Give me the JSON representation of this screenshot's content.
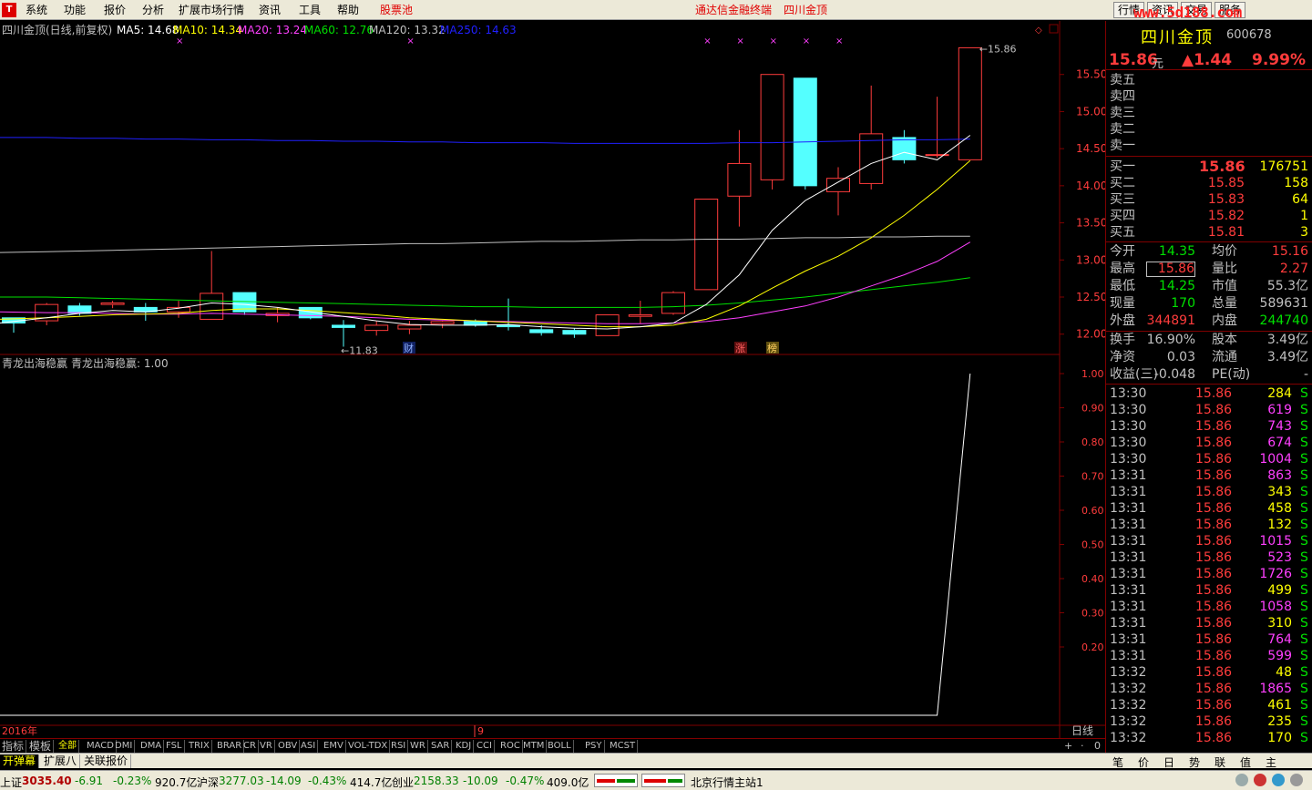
{
  "menu": [
    "系统",
    "功能",
    "报价",
    "分析",
    "扩展市场行情",
    "资讯",
    "工具",
    "帮助"
  ],
  "menu_red": "股票池",
  "center_title": "通达信金融终端",
  "center_stock": "四川金顶",
  "right_buttons": [
    "行情",
    "资讯",
    "交易",
    "服务"
  ],
  "watermark": "www.5d188.com",
  "header": {
    "title": "四川金顶(日线,前复权)",
    "ma5": "MA5: 14.68",
    "ma10": "MA10: 14.34",
    "ma20": "MA20: 13.24",
    "ma60": "MA60: 12.76",
    "ma120": "MA120: 13.32",
    "ma250": "MA250: 14.63"
  },
  "colors": {
    "ma5": "#ffffff",
    "ma10": "#ffff00",
    "ma20": "#ff40ff",
    "ma60": "#00e000",
    "ma120": "#c0c0c0",
    "ma250": "#2020ff",
    "up": "#ff3c3c",
    "down": "#54ffff"
  },
  "price_axis": [
    "15.50",
    "15.00",
    "14.50",
    "14.00",
    "13.50",
    "13.00",
    "12.50",
    "12.00"
  ],
  "labels": {
    "high_label": "15.86",
    "low_label": "11.83",
    "cai": "财",
    "zhang": "涨",
    "bang": "榜"
  },
  "indicator": {
    "title": "青龙出海稳赢",
    "value": "青龙出海稳赢: 1.00",
    "axis": [
      "1.00",
      "0.90",
      "0.80",
      "0.70",
      "0.60",
      "0.50",
      "0.40",
      "0.30",
      "0.20"
    ]
  },
  "x_axis": {
    "year": "2016年",
    "month": "9",
    "period": "日线"
  },
  "chart_data": {
    "type": "candlestick",
    "ylim": [
      11.8,
      16.0
    ],
    "candles": [
      {
        "o": 12.22,
        "h": 12.22,
        "l": 12.02,
        "c": 12.15
      },
      {
        "o": 12.18,
        "h": 12.42,
        "l": 12.12,
        "c": 12.4
      },
      {
        "o": 12.38,
        "h": 12.42,
        "l": 12.25,
        "c": 12.28
      },
      {
        "o": 12.4,
        "h": 12.45,
        "l": 12.35,
        "c": 12.42
      },
      {
        "o": 12.36,
        "h": 12.42,
        "l": 12.18,
        "c": 12.3
      },
      {
        "o": 12.3,
        "h": 12.45,
        "l": 12.22,
        "c": 12.36
      },
      {
        "o": 12.2,
        "h": 13.12,
        "l": 12.2,
        "c": 12.55
      },
      {
        "o": 12.56,
        "h": 12.56,
        "l": 12.26,
        "c": 12.3
      },
      {
        "o": 12.25,
        "h": 12.36,
        "l": 12.16,
        "c": 12.28
      },
      {
        "o": 12.36,
        "h": 12.36,
        "l": 12.2,
        "c": 12.22
      },
      {
        "o": 12.12,
        "h": 12.19,
        "l": 11.83,
        "c": 12.09
      },
      {
        "o": 12.05,
        "h": 12.18,
        "l": 11.98,
        "c": 12.12
      },
      {
        "o": 12.07,
        "h": 12.18,
        "l": 12.0,
        "c": 12.12
      },
      {
        "o": 12.14,
        "h": 12.18,
        "l": 12.08,
        "c": 12.17
      },
      {
        "o": 12.17,
        "h": 12.2,
        "l": 12.1,
        "c": 12.12
      },
      {
        "o": 12.12,
        "h": 12.48,
        "l": 12.05,
        "c": 12.1
      },
      {
        "o": 12.06,
        "h": 12.12,
        "l": 11.98,
        "c": 12.02
      },
      {
        "o": 12.05,
        "h": 12.08,
        "l": 11.95,
        "c": 12.0
      },
      {
        "o": 11.98,
        "h": 12.24,
        "l": 11.98,
        "c": 12.26
      },
      {
        "o": 12.24,
        "h": 12.45,
        "l": 12.14,
        "c": 12.26
      },
      {
        "o": 12.28,
        "h": 12.58,
        "l": 12.26,
        "c": 12.56
      },
      {
        "o": 12.6,
        "h": 13.82,
        "l": 12.6,
        "c": 13.82
      },
      {
        "o": 13.86,
        "h": 14.75,
        "l": 13.45,
        "c": 14.3
      },
      {
        "o": 14.08,
        "h": 15.5,
        "l": 13.95,
        "c": 15.5
      },
      {
        "o": 15.45,
        "h": 15.15,
        "l": 13.95,
        "c": 14.0
      },
      {
        "o": 13.92,
        "h": 14.25,
        "l": 13.6,
        "c": 14.1
      },
      {
        "o": 14.03,
        "h": 15.35,
        "l": 13.95,
        "c": 14.7
      },
      {
        "o": 14.65,
        "h": 14.75,
        "l": 14.3,
        "c": 14.35
      },
      {
        "o": 14.42,
        "h": 15.2,
        "l": 14.38,
        "c": 14.42
      },
      {
        "o": 14.35,
        "h": 15.86,
        "l": 14.35,
        "c": 15.86
      }
    ],
    "ma": {
      "ma5": [
        12.15,
        12.22,
        12.28,
        12.32,
        12.3,
        12.35,
        12.42,
        12.4,
        12.36,
        12.3,
        12.24,
        12.18,
        12.13,
        12.12,
        12.12,
        12.13,
        12.1,
        12.08,
        12.07,
        12.1,
        12.15,
        12.4,
        12.8,
        13.4,
        13.8,
        14.05,
        14.3,
        14.45,
        14.35,
        14.68
      ],
      "ma10": [
        12.2,
        12.22,
        12.24,
        12.26,
        12.27,
        12.28,
        12.32,
        12.34,
        12.34,
        12.32,
        12.29,
        12.26,
        12.22,
        12.2,
        12.18,
        12.16,
        12.14,
        12.12,
        12.1,
        12.1,
        12.12,
        12.2,
        12.38,
        12.62,
        12.85,
        13.05,
        13.3,
        13.6,
        13.95,
        14.34
      ],
      "ma20": [
        12.3,
        12.29,
        12.29,
        12.28,
        12.27,
        12.27,
        12.28,
        12.27,
        12.26,
        12.25,
        12.24,
        12.22,
        12.2,
        12.19,
        12.18,
        12.17,
        12.16,
        12.15,
        12.14,
        12.14,
        12.15,
        12.17,
        12.22,
        12.3,
        12.38,
        12.5,
        12.65,
        12.8,
        12.98,
        13.24
      ],
      "ma60": [
        12.5,
        12.5,
        12.49,
        12.48,
        12.47,
        12.46,
        12.45,
        12.44,
        12.43,
        12.42,
        12.41,
        12.4,
        12.39,
        12.38,
        12.37,
        12.37,
        12.36,
        12.36,
        12.36,
        12.36,
        12.37,
        12.39,
        12.42,
        12.46,
        12.5,
        12.55,
        12.6,
        12.65,
        12.7,
        12.76
      ],
      "ma120": [
        13.1,
        13.11,
        13.12,
        13.13,
        13.14,
        13.15,
        13.16,
        13.17,
        13.18,
        13.19,
        13.2,
        13.21,
        13.22,
        13.22,
        13.23,
        13.24,
        13.25,
        13.25,
        13.26,
        13.27,
        13.27,
        13.28,
        13.28,
        13.29,
        13.3,
        13.3,
        13.31,
        13.31,
        13.32,
        13.32
      ],
      "ma250": [
        14.65,
        14.65,
        14.64,
        14.64,
        14.63,
        14.63,
        14.62,
        14.62,
        14.61,
        14.61,
        14.6,
        14.6,
        14.59,
        14.59,
        14.58,
        14.58,
        14.58,
        14.57,
        14.57,
        14.57,
        14.57,
        14.57,
        14.58,
        14.58,
        14.59,
        14.6,
        14.61,
        14.62,
        14.62,
        14.63
      ]
    },
    "indicator_values": [
      0,
      0,
      0,
      0,
      0,
      0,
      0,
      0,
      0,
      0,
      0,
      0,
      0,
      0,
      0,
      0,
      0,
      0,
      0,
      0,
      0,
      0,
      0,
      0,
      0,
      0,
      0,
      0,
      0,
      1
    ],
    "indicator_ylim": [
      0,
      1.0
    ],
    "markers": [
      5,
      12,
      21,
      22,
      23,
      24,
      25
    ]
  },
  "panel": {
    "name": "四川金顶",
    "code": "600678",
    "price": "15.86",
    "price_unit": "元",
    "change": "▲1.44",
    "pct": "9.99%",
    "sells": [
      "卖五",
      "卖四",
      "卖三",
      "卖二",
      "卖一"
    ],
    "buys": [
      {
        "label": "买一",
        "price": "15.86",
        "vol": "176751"
      },
      {
        "label": "买二",
        "price": "15.85",
        "vol": "158"
      },
      {
        "label": "买三",
        "price": "15.83",
        "vol": "64"
      },
      {
        "label": "买四",
        "price": "15.82",
        "vol": "1"
      },
      {
        "label": "买五",
        "price": "15.81",
        "vol": "3"
      }
    ],
    "stats": [
      {
        "l1": "今开",
        "v1": "14.35",
        "l2": "均价",
        "v2": "15.16",
        "c1": "#00e000",
        "c2": "#ff3c3c"
      },
      {
        "l1": "最高",
        "v1": "15.86",
        "l2": "量比",
        "v2": "2.27",
        "c1": "#ff3c3c",
        "c2": "#ff3c3c"
      },
      {
        "l1": "最低",
        "v1": "14.25",
        "l2": "市值",
        "v2": "55.3亿",
        "c1": "#00e000",
        "c2": "#c0c0c0"
      },
      {
        "l1": "现量",
        "v1": "170",
        "l2": "总量",
        "v2": "589631",
        "c1": "#00e000",
        "c2": "#c0c0c0"
      },
      {
        "l1": "外盘",
        "v1": "344891",
        "l2": "内盘",
        "v2": "244740",
        "c1": "#ff3c3c",
        "c2": "#00e000"
      }
    ],
    "stats2": [
      {
        "l1": "换手",
        "v1": "16.90%",
        "l2": "股本",
        "v2": "3.49亿"
      },
      {
        "l1": "净资",
        "v1": "0.03",
        "l2": "流通",
        "v2": "3.49亿"
      },
      {
        "l1": "收益(三)",
        "v1": "-0.048",
        "l2": "PE(动)",
        "v2": "-"
      }
    ],
    "ticks": [
      {
        "t": "13:30",
        "p": "15.86",
        "v": "284",
        "c": "#ffff00"
      },
      {
        "t": "13:30",
        "p": "15.86",
        "v": "619",
        "c": "#ff40ff"
      },
      {
        "t": "13:30",
        "p": "15.86",
        "v": "743",
        "c": "#ff40ff"
      },
      {
        "t": "13:30",
        "p": "15.86",
        "v": "674",
        "c": "#ff40ff"
      },
      {
        "t": "13:30",
        "p": "15.86",
        "v": "1004",
        "c": "#ff40ff"
      },
      {
        "t": "13:31",
        "p": "15.86",
        "v": "863",
        "c": "#ff40ff"
      },
      {
        "t": "13:31",
        "p": "15.86",
        "v": "343",
        "c": "#ffff00"
      },
      {
        "t": "13:31",
        "p": "15.86",
        "v": "458",
        "c": "#ffff00"
      },
      {
        "t": "13:31",
        "p": "15.86",
        "v": "132",
        "c": "#ffff00"
      },
      {
        "t": "13:31",
        "p": "15.86",
        "v": "1015",
        "c": "#ff40ff"
      },
      {
        "t": "13:31",
        "p": "15.86",
        "v": "523",
        "c": "#ff40ff"
      },
      {
        "t": "13:31",
        "p": "15.86",
        "v": "1726",
        "c": "#ff40ff"
      },
      {
        "t": "13:31",
        "p": "15.86",
        "v": "499",
        "c": "#ffff00"
      },
      {
        "t": "13:31",
        "p": "15.86",
        "v": "1058",
        "c": "#ff40ff"
      },
      {
        "t": "13:31",
        "p": "15.86",
        "v": "310",
        "c": "#ffff00"
      },
      {
        "t": "13:31",
        "p": "15.86",
        "v": "764",
        "c": "#ff40ff"
      },
      {
        "t": "13:31",
        "p": "15.86",
        "v": "599",
        "c": "#ff40ff"
      },
      {
        "t": "13:32",
        "p": "15.86",
        "v": "48",
        "c": "#ffff00"
      },
      {
        "t": "13:32",
        "p": "15.86",
        "v": "1865",
        "c": "#ff40ff"
      },
      {
        "t": "13:32",
        "p": "15.86",
        "v": "461",
        "c": "#ffff00"
      },
      {
        "t": "13:32",
        "p": "15.86",
        "v": "235",
        "c": "#ffff00"
      },
      {
        "t": "13:32",
        "p": "15.86",
        "v": "170",
        "c": "#ffff00"
      }
    ],
    "tick_side": "S"
  },
  "tabs": [
    "指标",
    "模板",
    "全部",
    "MACD",
    "DMI",
    "DMA",
    "FSL",
    "TRIX",
    "BRAR",
    "CR",
    "VR",
    "OBV",
    "ASI",
    "EMV",
    "VOL-TDX",
    "RSI",
    "WR",
    "SAR",
    "KDJ",
    "CCI",
    "ROC",
    "MTM",
    "BOLL",
    "PSY",
    "MCST"
  ],
  "tabs2": [
    "开弹幕",
    "扩展八",
    "关联报价"
  ],
  "rtabs": [
    "笔",
    "价",
    "日",
    "势",
    "联",
    "值",
    "主"
  ],
  "status": {
    "sh_name": "上证",
    "sh_val": "3035.40",
    "sh_chg": "-6.91",
    "sh_pct": "-0.23%",
    "sh_amt": "920.7亿",
    "hs_name": "沪深",
    "hs_val": "3277.03",
    "hs_chg": "-14.09",
    "hs_pct": "-0.43%",
    "hs_amt": "414.7亿",
    "cy_name": "创业",
    "cy_val": "2158.33",
    "cy_chg": "-10.09",
    "cy_pct": "-0.47%",
    "cy_amt": "409.0亿",
    "server": "北京行情主站1"
  }
}
